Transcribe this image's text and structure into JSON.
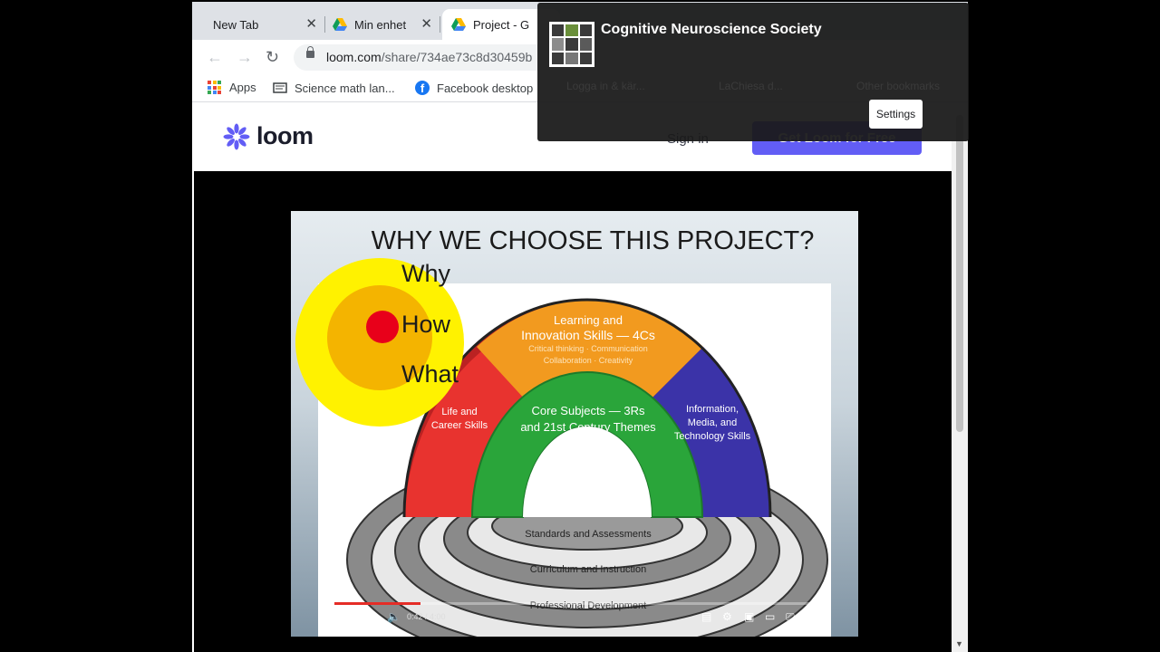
{
  "browser": {
    "tabs": [
      {
        "title": "New Tab",
        "close": "✕"
      },
      {
        "title": "Min enhet",
        "close": "✕"
      },
      {
        "title": "Project - G"
      }
    ],
    "url_host": "loom.com",
    "url_path": "/share/734ae73c8d30459b",
    "bookmarks": [
      {
        "label": "Apps"
      },
      {
        "label": "Science math lan..."
      },
      {
        "label": "Facebook desktop"
      },
      {
        "label": "Logga in & kär..."
      },
      {
        "label": "LaChiesa d..."
      },
      {
        "label": "Other bookmarks"
      }
    ]
  },
  "loom": {
    "logo_text": "loom",
    "sign_in": "Sign in",
    "cta": "Get Loom for Free",
    "brand_color": "#625df5"
  },
  "slide": {
    "title": "WHY WE CHOOSE THIS PROJECT?",
    "circle_labels": [
      "Why",
      "How",
      "What"
    ],
    "arch": {
      "top": "Learning and",
      "top2": "Innovation Skills — 4Cs",
      "top_sub1": "Critical thinking · Communication",
      "top_sub2": "Collaboration · Creativity",
      "left1": "Life and",
      "left2": "Career Skills",
      "right1": "Information,",
      "right2": "Media, and",
      "right3": "Technology Skills",
      "core1": "Core Subjects — 3Rs",
      "core2": "and 21st Century Themes"
    },
    "rings": [
      "Standards and Assessments",
      "Curriculum and Instruction",
      "Professional Development"
    ]
  },
  "player": {
    "time": "0:42 / 4:00",
    "progress": 0.175
  },
  "notification": {
    "title": "Cognitive Neuroscience Society",
    "button": "Settings"
  }
}
